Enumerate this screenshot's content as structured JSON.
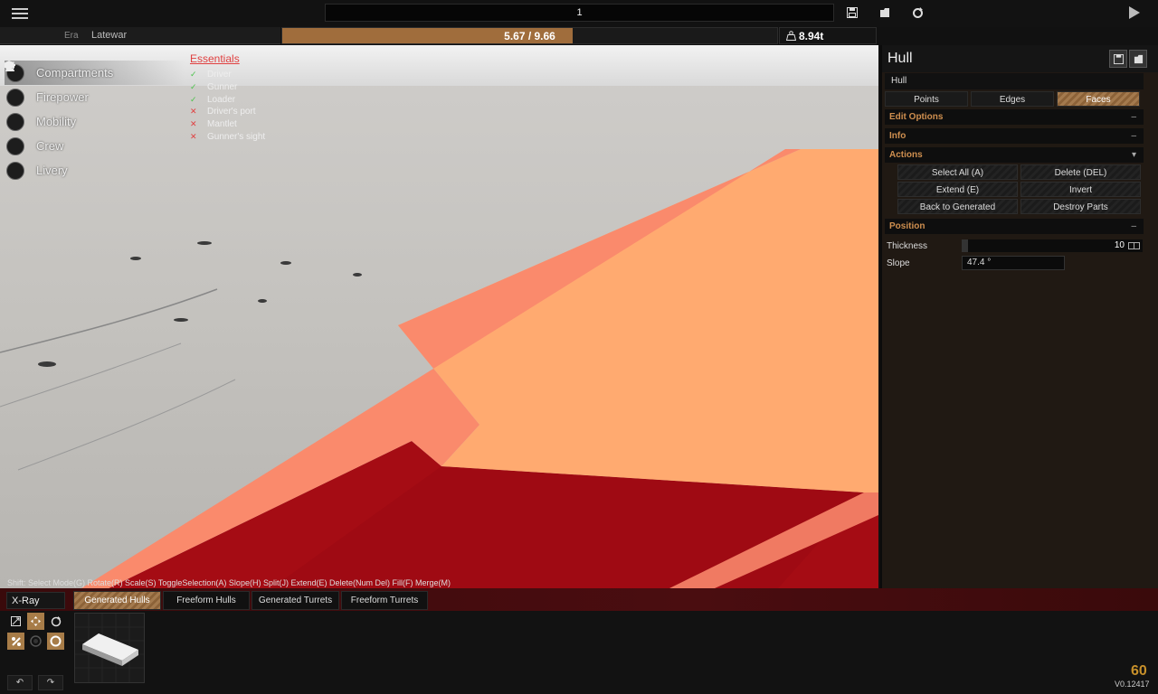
{
  "topbar": {
    "field_value": "1",
    "icons": [
      "menu-icon",
      "save-icon",
      "open-folder-icon",
      "refresh-icon",
      "play-icon"
    ]
  },
  "era": {
    "label": "Era",
    "value": "Latewar"
  },
  "cost": {
    "text": "5.67 / 9.66",
    "fill_fraction": 0.587
  },
  "weight": {
    "text": "8.94t"
  },
  "sidebar": {
    "items": [
      {
        "label": "Compartments",
        "icon": "cube-icon"
      },
      {
        "label": "Firepower",
        "icon": "gun-icon"
      },
      {
        "label": "Mobility",
        "icon": "wheel-icon"
      },
      {
        "label": "Crew",
        "icon": "person-icon"
      },
      {
        "label": "Livery",
        "icon": "brush-icon"
      }
    ]
  },
  "essentials": {
    "title": "Essentials",
    "items": [
      {
        "label": "Driver",
        "mark": "✓",
        "status": "ok"
      },
      {
        "label": "Gunner",
        "mark": "✓",
        "status": "ok"
      },
      {
        "label": "Loader",
        "mark": "✓",
        "status": "ok"
      },
      {
        "label": "Driver's port",
        "mark": "✕",
        "status": "missing"
      },
      {
        "label": "Mantlet",
        "mark": "✕",
        "status": "missing"
      },
      {
        "label": "Gunner's sight",
        "mark": "✕",
        "status": "missing"
      }
    ]
  },
  "shortcuts": "Shift: Select Mode(G) Rotate(R) Scale(S) ToggleSelection(A) Slope(H) Split(J) Extend(E) Delete(Num Del) Fill(F) Merge(M)",
  "panel": {
    "title": "Hull",
    "part_name": "Hull",
    "modes": [
      "Points",
      "Edges",
      "Faces"
    ],
    "active_mode": "Faces",
    "sections": {
      "edit_options": "Edit Options",
      "info": "Info",
      "actions": "Actions",
      "position": "Position"
    },
    "actions": [
      "Select All (A)",
      "Delete (DEL)",
      "Extend (E)",
      "Invert",
      "Back to Generated",
      "Destroy Parts"
    ],
    "thickness_label": "Thickness",
    "thickness_value": "10",
    "slope_label": "Slope",
    "slope_value": "47.4 °"
  },
  "bottom": {
    "xray_label": "X-Ray",
    "tabs": [
      "Generated Hulls",
      "Freeform Hulls",
      "Generated Turrets",
      "Freeform Turrets"
    ],
    "active_tab": "Generated Hulls"
  },
  "fps": "60",
  "version": "V0.12417",
  "colors": {
    "accent": "#a06d3c",
    "section_title": "#cf8f4f",
    "error_red": "#e04040",
    "ok_green": "#4cc34c",
    "fps": "#c7902a"
  }
}
